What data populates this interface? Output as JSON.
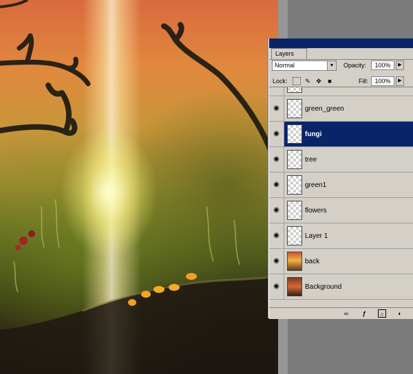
{
  "panel": {
    "tab_label": "Layers",
    "blend_mode": "Normal",
    "opacity_label": "Opacity:",
    "opacity_value": "100%",
    "lock_label": "Lock:",
    "fill_label": "Fill:",
    "fill_value": "100%"
  },
  "layers": [
    {
      "name": "green_green",
      "selected": false
    },
    {
      "name": "fungi",
      "selected": true
    },
    {
      "name": "tree",
      "selected": false
    },
    {
      "name": "green1",
      "selected": false
    },
    {
      "name": "flowers",
      "selected": false
    },
    {
      "name": "Layer 1",
      "selected": false
    },
    {
      "name": "back",
      "selected": false
    },
    {
      "name": "Background",
      "selected": false
    }
  ],
  "colors": {
    "selection": "#0a246a",
    "panel": "#d4d0c8"
  },
  "icons": {
    "visibility": "eye-icon",
    "lock_transparent": "lock-transparency-icon",
    "lock_paint": "brush-icon",
    "lock_move": "move-icon",
    "lock_all": "padlock-icon",
    "link": "link-icon",
    "fx": "layer-style-icon",
    "mask": "mask-icon",
    "adjust": "adjustment-icon"
  }
}
